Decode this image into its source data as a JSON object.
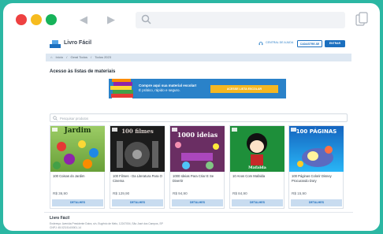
{
  "header": {
    "brand": "Livro Fácil",
    "help_label": "CENTRAL DE AJUDA",
    "register_label": "CADASTRE-SE",
    "login_label": "ENTRAR"
  },
  "breadcrumb": [
    "Início",
    "Geral Todos",
    "Todos 2023"
  ],
  "main": {
    "title": "Acesso às listas de materiais"
  },
  "banner": {
    "line1": "Compre aqui sua material escolar!",
    "line2": "É prático, rápido e seguro.",
    "button_label": "ACESSE LISTA ESCOLAR"
  },
  "search": {
    "placeholder": "Pesquisar produtos"
  },
  "products": [
    {
      "name": "100 Coisas do Jardim",
      "price": "R$ 36,90",
      "button": "DETALHES",
      "cover_text": "Jardim",
      "cover_color": "#7cb342"
    },
    {
      "name": "100 Filmes - Da Literatura Para O Cinema",
      "price": "R$ 129,90",
      "button": "DETALHES",
      "cover_text": "100 filmes",
      "cover_color": "#212121"
    },
    {
      "name": "1000 Ideias Para Criar E Se Divertir",
      "price": "R$ 94,90",
      "button": "DETALHES",
      "cover_text": "1000 ideias",
      "cover_color": "#7e3a74"
    },
    {
      "name": "10 Anos Com Mafalda",
      "price": "R$ 84,90",
      "button": "DETALHES",
      "cover_text": "Mafalda",
      "cover_color": "#1e8f3a"
    },
    {
      "name": "100 Páginas Colorir Disney Procurando Dory",
      "price": "R$ 15,90",
      "button": "DETALHES",
      "cover_text": "100 PÁGINAS",
      "cover_color": "#1f6fd1"
    }
  ],
  "footer": {
    "brand": "Livro Fácil",
    "address": "Endereço: Avenida Presidente Dutra, s/n, Eugênio de Melo, 12247004, São José dos Campos, SP",
    "cnpj": "CNPJ: 45.023.514/0001-14"
  },
  "colors": {
    "background": "#2bb7a3",
    "accent_blue": "#1b6fbf",
    "banner_blue": "#2a82c9",
    "banner_button": "#f5b722"
  }
}
